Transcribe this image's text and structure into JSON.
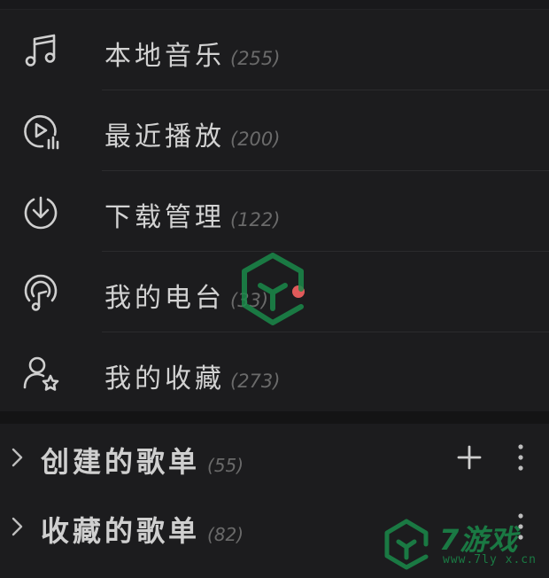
{
  "menu": {
    "items": [
      {
        "label": "本地音乐",
        "count": "(255)",
        "icon": "music-note-icon"
      },
      {
        "label": "最近播放",
        "count": "(200)",
        "icon": "recent-play-icon"
      },
      {
        "label": "下载管理",
        "count": "(122)",
        "icon": "download-icon"
      },
      {
        "label": "我的电台",
        "count": "(33)",
        "icon": "radio-podcast-icon"
      },
      {
        "label": "我的收藏",
        "count": "(273)",
        "icon": "user-star-icon"
      }
    ]
  },
  "playlists": {
    "created": {
      "title": "创建的歌单",
      "count": "(55)"
    },
    "collected": {
      "title": "收藏的歌单",
      "count": "(82)"
    }
  },
  "watermark": {
    "brand": "7游戏",
    "site": "www.7ly x.cn"
  },
  "colors": {
    "background": "#1c1c1e",
    "icon": "#cfcfcf",
    "count_text": "#6a6a6a",
    "badge": "#e05a5a",
    "watermark": "#1a8a4a"
  }
}
